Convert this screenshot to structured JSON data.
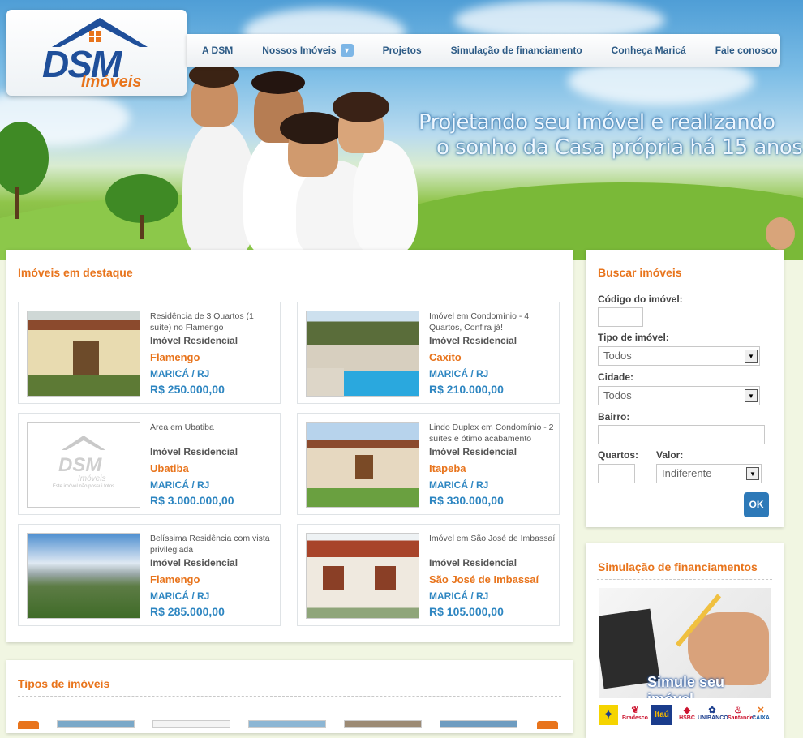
{
  "brand": {
    "name": "DSM",
    "subname": "Imóveis",
    "accent": "#e8741c",
    "primary": "#1f4f9a"
  },
  "nav": {
    "items": [
      "A DSM",
      "Nossos Imóveis",
      "Projetos",
      "Simulação de financiamento",
      "Conheça Maricá",
      "Fale conosco"
    ]
  },
  "hero": {
    "line1": "Projetando seu imóvel e realizando",
    "line2": "o sonho da Casa própria há 15 anos"
  },
  "featured": {
    "title": "Imóveis em destaque",
    "cards": [
      {
        "desc": "Residência de 3 Quartos (1 suíte) no Flamengo",
        "type": "Imóvel Residencial",
        "neighborhood": "Flamengo",
        "city": "MARICÁ / RJ",
        "price": "R$ 250.000,00",
        "image": "house-porch-photo"
      },
      {
        "desc": "Imóvel em Condomínio - 4 Quartos, Confira já!",
        "type": "Imóvel Residencial",
        "neighborhood": "Caxito",
        "city": "MARICÁ / RJ",
        "price": "R$ 210.000,00",
        "image": "pool-house-photo"
      },
      {
        "desc": "Área em Ubatiba",
        "type": "Imóvel Residencial",
        "neighborhood": "Ubatiba",
        "city": "MARICÁ / RJ",
        "price": "R$ 3.000.000,00",
        "image": "placeholder-logo",
        "placeholder_text": "Este imóvel não possui fotos"
      },
      {
        "desc": "Lindo Duplex em Condomínio - 2 suítes e ótimo acabamento",
        "type": "Imóvel Residencial",
        "neighborhood": "Itapeba",
        "city": "MARICÁ / RJ",
        "price": "R$ 330.000,00",
        "image": "duplex-photo"
      },
      {
        "desc": "Belíssima Residência com vista privilegiada",
        "type": "Imóvel Residencial",
        "neighborhood": "Flamengo",
        "city": "MARICÁ / RJ",
        "price": "R$ 285.000,00",
        "image": "mountain-view-photo"
      },
      {
        "desc": "Imóvel em São José de Imbassaí",
        "type": "Imóvel Residencial",
        "neighborhood": "São José de Imbassaí",
        "city": "MARICÁ / RJ",
        "price": "R$ 105.000,00",
        "image": "small-house-photo"
      }
    ]
  },
  "search": {
    "title": "Buscar imóveis",
    "code_label": "Código do imóvel:",
    "code_value": "",
    "type_label": "Tipo de imóvel:",
    "type_value": "Todos",
    "city_label": "Cidade:",
    "city_value": "Todos",
    "district_label": "Bairro:",
    "district_value": "",
    "rooms_label": "Quartos:",
    "rooms_value": "",
    "value_label": "Valor:",
    "value_value": "Indiferente",
    "submit": "OK"
  },
  "financing": {
    "title": "Simulação de financiamentos",
    "banner_text": "Simule seu imóvel",
    "banks": [
      "Bradesco",
      "Itaú",
      "HSBC",
      "UNIBANCO",
      "Santander",
      "CAIXA"
    ]
  },
  "types": {
    "title": "Tipos de imóveis"
  }
}
